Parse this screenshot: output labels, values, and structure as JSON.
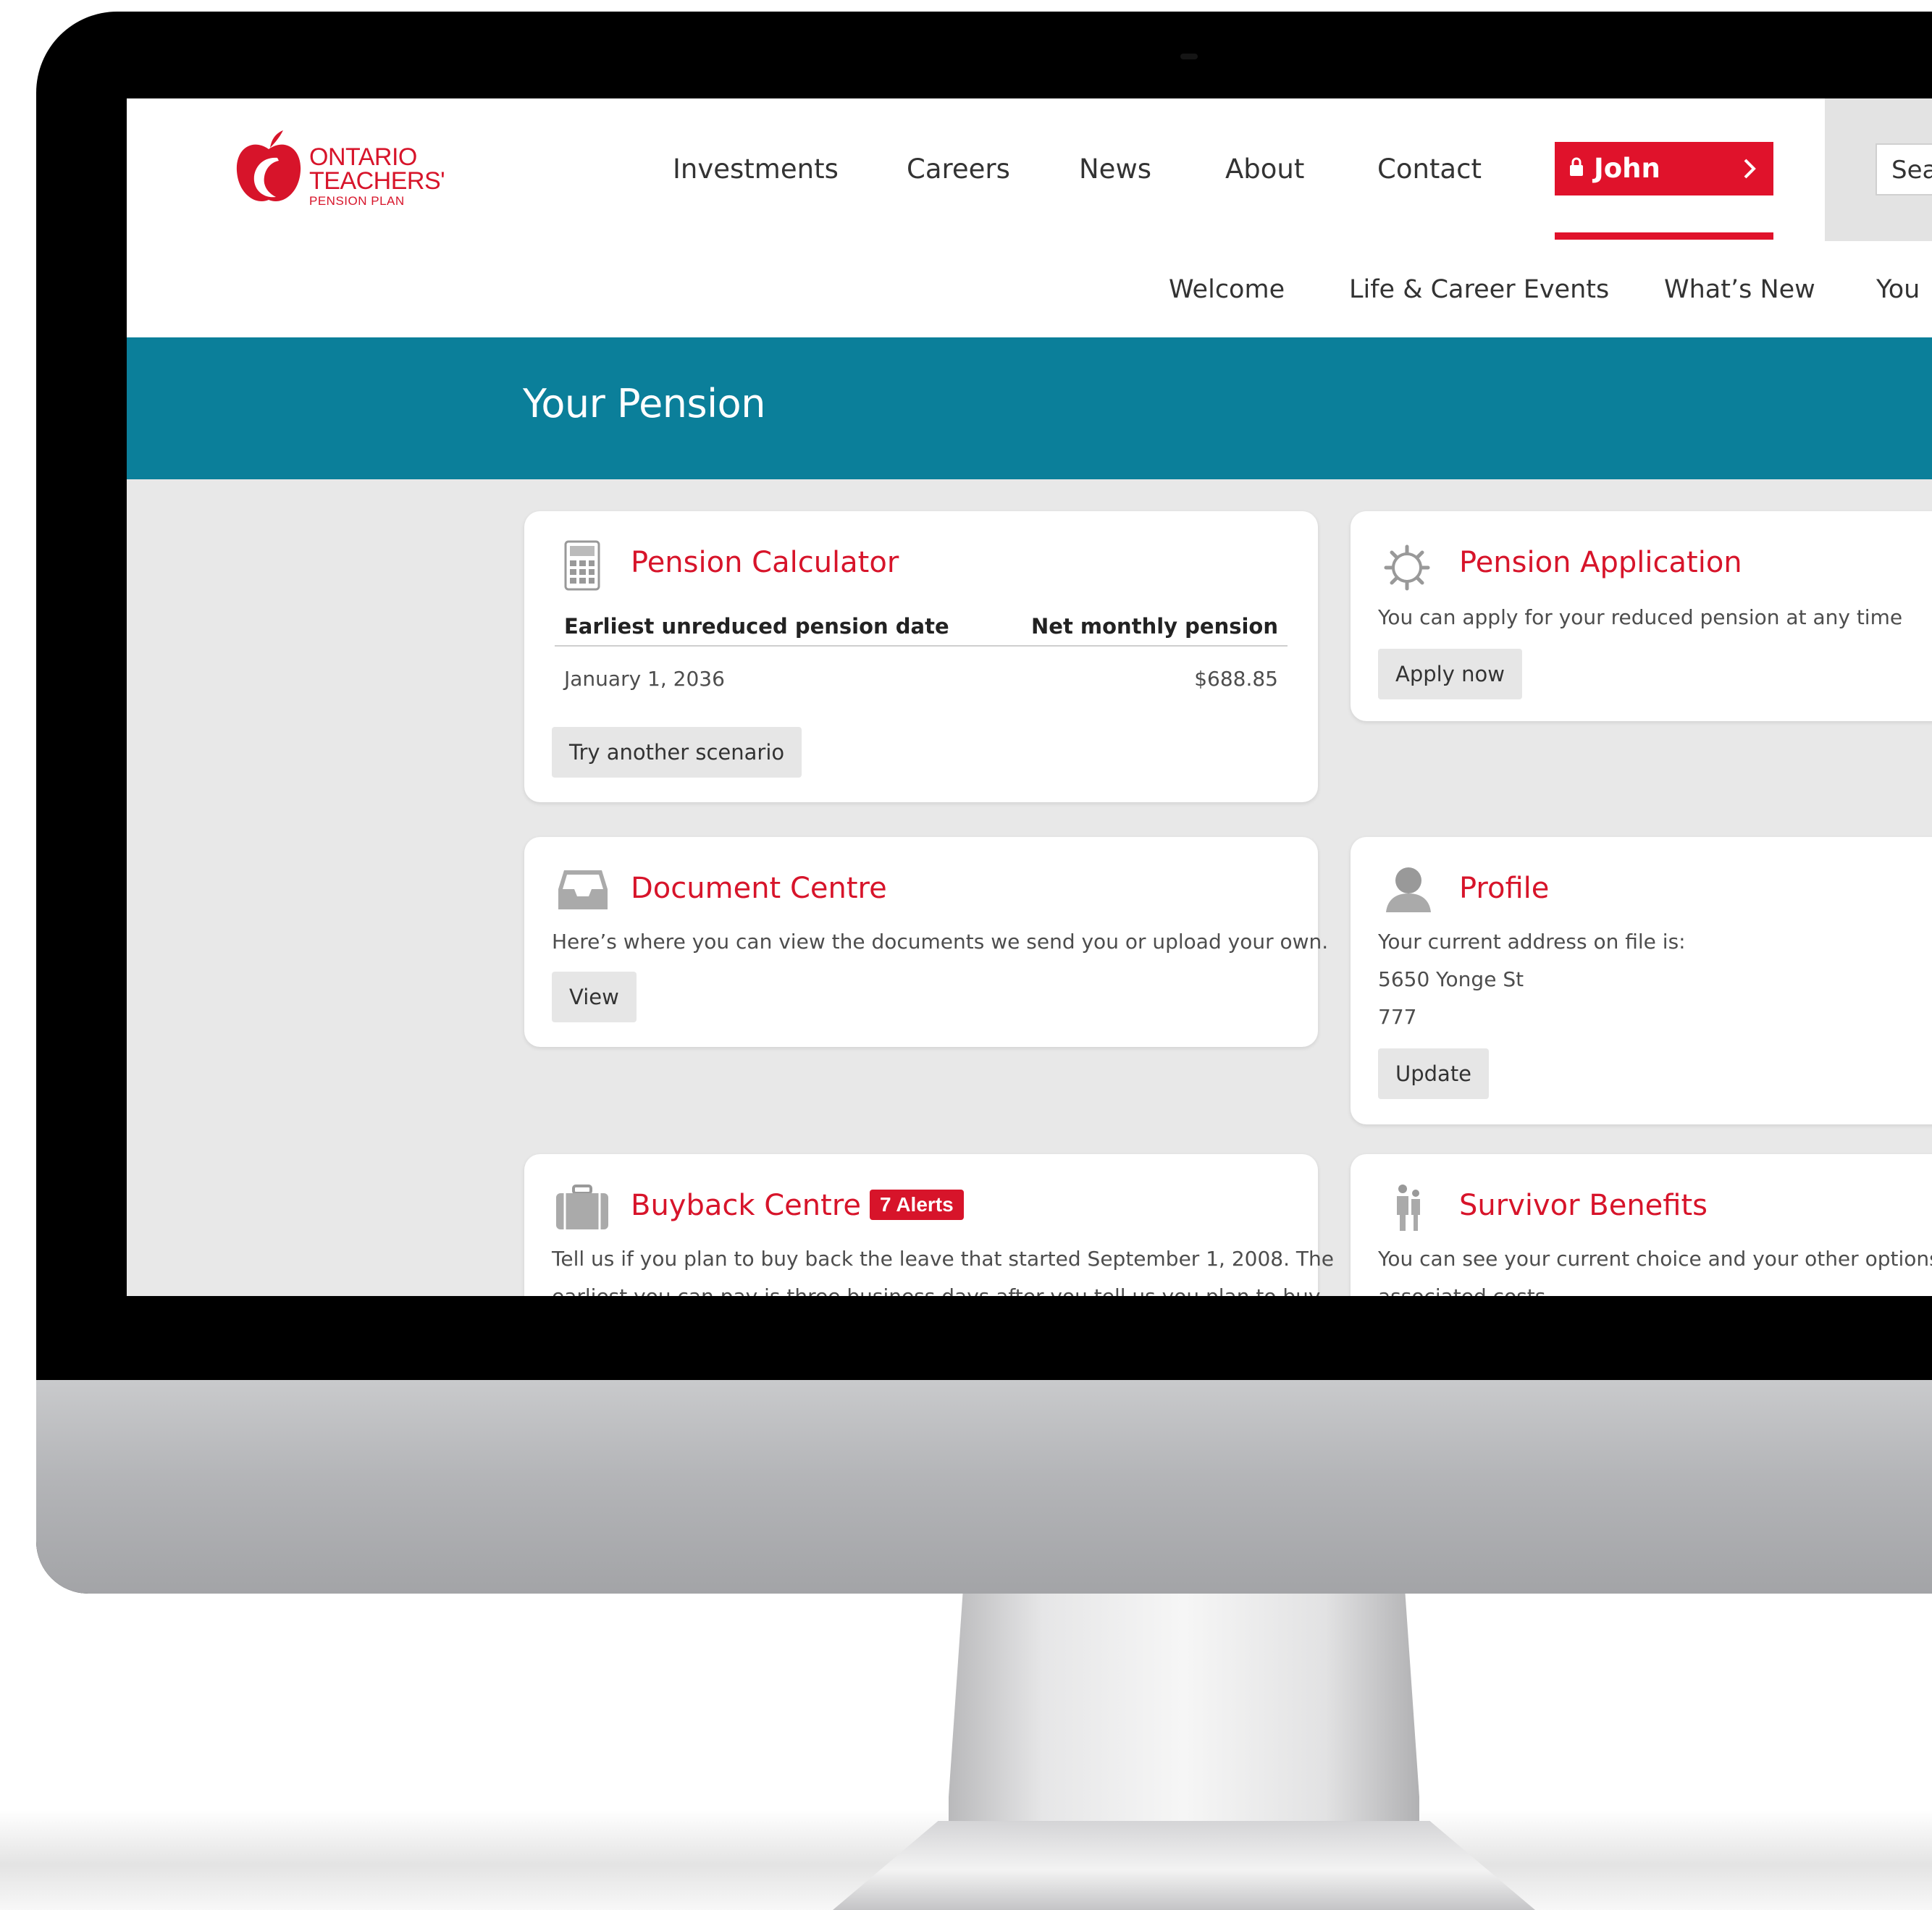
{
  "brand": {
    "line1": "ONTARIO",
    "line2": "TEACHERS'",
    "line3": "PENSION PLAN",
    "accent": "#d7142a",
    "teal": "#0b7f9a"
  },
  "nav": {
    "items": [
      "Investments",
      "Careers",
      "News",
      "About",
      "Contact"
    ],
    "user": "John",
    "search_text": "Sea"
  },
  "subnav": {
    "items": [
      "Welcome",
      "Life & Career Events",
      "What’s New",
      "You"
    ]
  },
  "banner": {
    "title": "Your Pension"
  },
  "cards": {
    "pension_calculator": {
      "title": "Pension Calculator",
      "col1_header": "Earliest unreduced pension date",
      "col2_header": "Net monthly pension",
      "col1_value": "January 1, 2036",
      "col2_value": "$688.85",
      "button": "Try another scenario",
      "icon": "calculator-icon"
    },
    "pension_application": {
      "title": "Pension Application",
      "text": "You can apply for your reduced pension at any time",
      "button": "Apply now",
      "icon": "gear-icon"
    },
    "document_centre": {
      "title": "Document Centre",
      "text": "Here’s where you can view the documents we send you or upload your own.",
      "button": "View",
      "icon": "inbox-tray-icon"
    },
    "profile": {
      "title": "Profile",
      "text": "Your current address on file is:",
      "address_line1": "5650 Yonge St",
      "address_line2": "777",
      "button": "Update",
      "icon": "person-icon"
    },
    "buyback_centre": {
      "title": "Buyback Centre",
      "badge": "7 Alerts",
      "text_line1": "Tell us if you plan to buy back the leave that started September 1, 2008. The",
      "text_line2": "earliest you can pay is three business days after you tell us you plan to buy",
      "icon": "briefcase-icon"
    },
    "survivor_benefits": {
      "title": "Survivor Benefits",
      "text_line1": "You can see your current choice and your other options as w",
      "text_line2": "associated costs",
      "icon": "family-icon"
    }
  }
}
